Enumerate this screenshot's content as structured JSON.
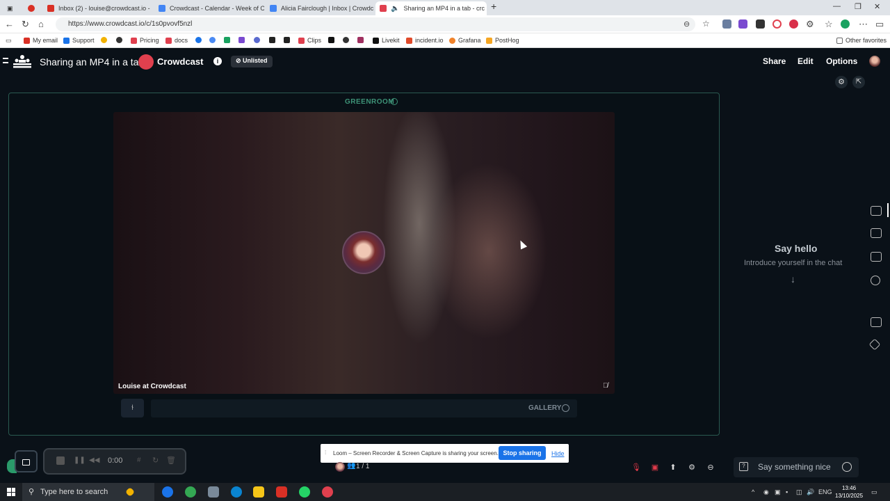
{
  "browser": {
    "tabs": [
      {
        "label": "Inbox (2) - louise@crowdcast.io - ",
        "color": "#d93025"
      },
      {
        "label": "Crowdcast - Calendar - Week of O",
        "color": "#4285f4"
      },
      {
        "label": "Alicia Fairclough | Inbox | Crowdc",
        "color": "#4285f4"
      },
      {
        "label": "Sharing an MP4 in a tab - crc",
        "color": "#e0404e"
      }
    ],
    "url": "https://www.crowdcast.io/c/1s0pvovf5nzl",
    "bookmarks": [
      "My email",
      "Support",
      "Pricing",
      "docs",
      "Clips",
      "Livekit",
      "incident.io",
      "Grafana",
      "PostHog"
    ],
    "other_favorites": "Other favorites"
  },
  "app": {
    "title": "Sharing an MP4 in a tab",
    "brand": "Crowdcast",
    "info_icon": "i",
    "visibility": "Unlisted",
    "header_buttons": {
      "share": "Share",
      "edit": "Edit",
      "options": "Options"
    }
  },
  "stage": {
    "greenroom": "GREENROOM",
    "participant_name": "Louise at Crowdcast",
    "gallery": "GALLERY"
  },
  "chat": {
    "title": "Say hello",
    "subtitle": "Introduce yourself in the chat",
    "placeholder": "Say something nice"
  },
  "loom": {
    "time": "0:00",
    "banner_text": "Loom – Screen Recorder & Screen Capture is sharing your screen.",
    "stop_label": "Stop sharing",
    "hide_label": "Hide"
  },
  "viewers": {
    "count": "1 / 1"
  },
  "taskbar": {
    "search_placeholder": "Type here to search",
    "language": "ENG",
    "time": "13:46",
    "date": "13/10/2025"
  }
}
